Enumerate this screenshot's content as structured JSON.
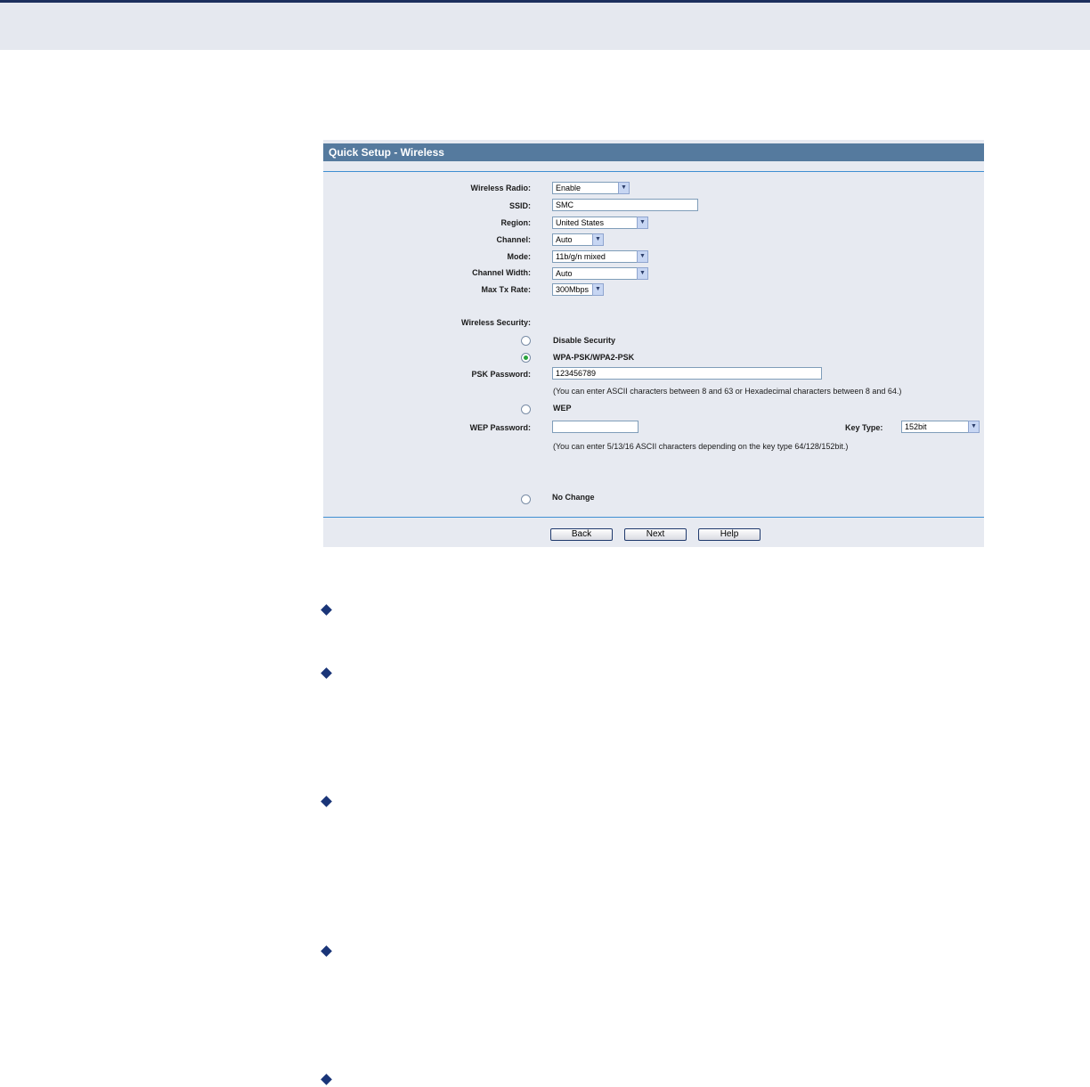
{
  "panel": {
    "title": "Quick Setup - Wireless"
  },
  "fields": {
    "wireless_radio": {
      "label": "Wireless Radio:",
      "value": "Enable"
    },
    "ssid": {
      "label": "SSID:",
      "value": "SMC"
    },
    "region": {
      "label": "Region:",
      "value": "United States"
    },
    "channel": {
      "label": "Channel:",
      "value": "Auto"
    },
    "mode": {
      "label": "Mode:",
      "value": "11b/g/n mixed"
    },
    "channel_width": {
      "label": "Channel Width:",
      "value": "Auto"
    },
    "max_tx_rate": {
      "label": "Max Tx Rate:",
      "value": "300Mbps"
    }
  },
  "security": {
    "label": "Wireless Security:",
    "selected": "wpa-psk",
    "options": {
      "disable": "Disable Security",
      "wpa_psk": "WPA-PSK/WPA2-PSK",
      "wep": "WEP",
      "no_change": "No Change"
    },
    "psk_password": {
      "label": "PSK Password:",
      "value": "123456789",
      "hint": "(You can enter ASCII characters between 8 and 63 or Hexadecimal characters between 8 and 64.)"
    },
    "wep_password": {
      "label": "WEP Password:",
      "value": "",
      "hint": "(You can enter 5/13/16 ASCII characters depending on the key type 64/128/152bit.)"
    },
    "key_type": {
      "label": "Key Type:",
      "value": "152bit"
    }
  },
  "buttons": {
    "back": "Back",
    "next": "Next",
    "help": "Help"
  },
  "icons": {
    "dropdown": "chevron-down-icon",
    "bullet": "diamond-bullet-icon"
  },
  "colors": {
    "header_band": "#e5e8ef",
    "header_border": "#1c2f5d",
    "panel_bg": "#e7eaf1",
    "title_bar": "#557a9e",
    "divider": "#3f8fd2",
    "bullet": "#1a3578",
    "radio_selected": "#29a33c"
  }
}
